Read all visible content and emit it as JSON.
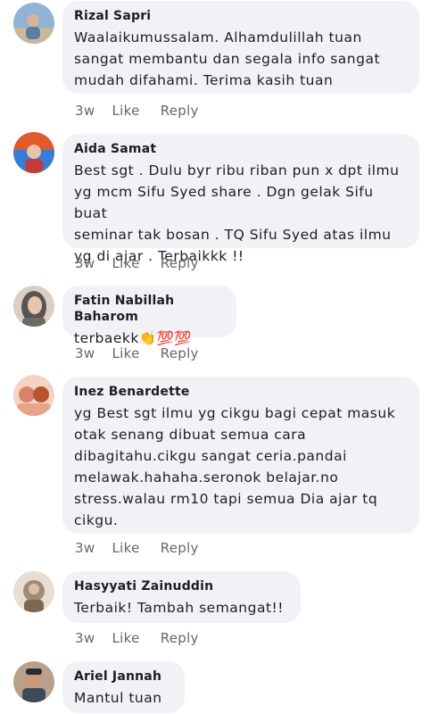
{
  "comments": [
    {
      "name": "Rizal Sapri",
      "text": "Waalaikumussalam. Alhamdulillah tuan\nsangat membantu dan segala info sangat\nmudah difahami. Terima kasih tuan",
      "time": "3w",
      "like": "Like",
      "reply": "Reply",
      "avatar_colors": [
        "#7fa7c9",
        "#c8b49a"
      ]
    },
    {
      "name": "Aida Samat",
      "text": "Best sgt . Dulu byr ribu riban pun x dpt ilmu\nyg mcm Sifu Syed share . Dgn gelak Sifu buat\nseminar tak bosan . TQ Sifu Syed atas ilmu\nyg di ajar . Terbaikkk !!",
      "time": "3w",
      "like": "Like",
      "reply": "Reply",
      "avatar_colors": [
        "#e05a2b",
        "#3a7bd5"
      ]
    },
    {
      "name": "Fatin Nabillah Baharom",
      "text": "terbaekk👏💯💯",
      "time": "3w",
      "like": "Like",
      "reply": "Reply",
      "avatar_colors": [
        "#6d6a65",
        "#d9cfc3"
      ]
    },
    {
      "name": "Inez Benardette",
      "text": "yg Best sgt ilmu yg cikgu bagi cepat masuk\notak senang dibuat semua cara\ndibagitahu.cikgu sangat ceria.pandai\nmelawak.hahaha.seronok belajar.no\nstress.walau rm10 tapi semua Dia ajar tq\ncikgu.",
      "time": "3w",
      "like": "Like",
      "reply": "Reply",
      "avatar_colors": [
        "#d9826a",
        "#f2d3c4"
      ]
    },
    {
      "name": "Hasyyati Zainuddin",
      "text": "Terbaik! Tambah semangat!!",
      "time": "3w",
      "like": "Like",
      "reply": "Reply",
      "avatar_colors": [
        "#a48a72",
        "#e7ddd2"
      ]
    },
    {
      "name": "Ariel Jannah",
      "text": "Mantul tuan",
      "time": "",
      "like": "",
      "reply": "",
      "avatar_colors": [
        "#3d4a5a",
        "#b8a08a"
      ]
    }
  ]
}
